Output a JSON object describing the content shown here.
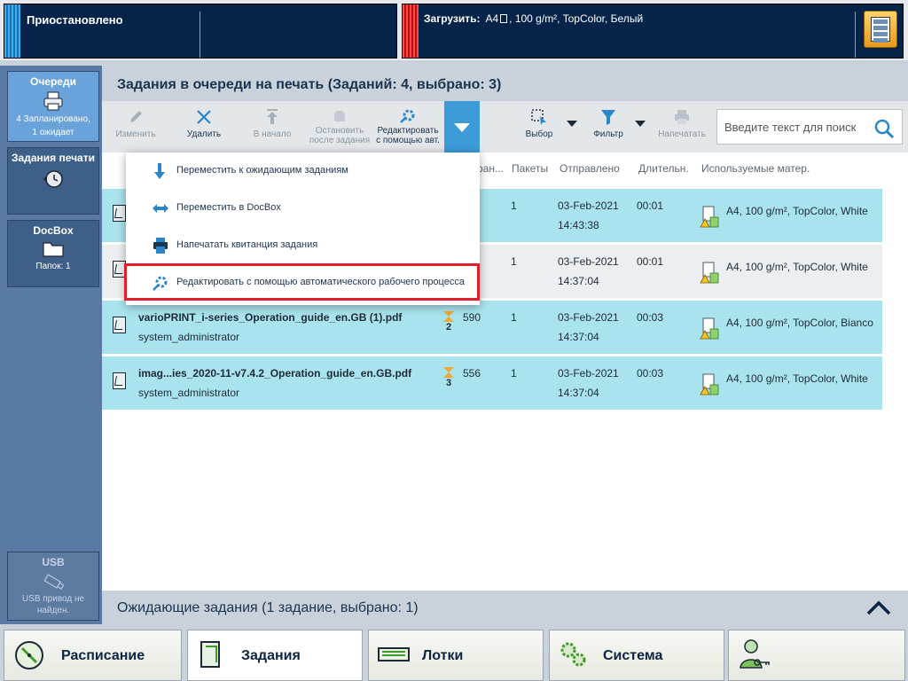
{
  "status_bar": {
    "printer_status": "Приостановлено",
    "load_label": "Загрузить:",
    "load_media_size": "A4",
    "load_media_details": ", 100 g/m², TopColor, Белый"
  },
  "sidebar": {
    "queues": {
      "title": "Очереди",
      "line1": "4 Запланировано,",
      "line2": "1 ожидает"
    },
    "print_jobs": {
      "title": "Задания печати"
    },
    "docbox": {
      "title": "DocBox",
      "sub": "Папок: 1"
    },
    "usb": {
      "title": "USB",
      "sub": "USB привод не найден."
    }
  },
  "main": {
    "title": "Задания в очереди на печать (Заданий: 4, выбрано: 3)",
    "toolbar": {
      "edit": "Изменить",
      "delete": "Удалить",
      "to_top": "В начало",
      "stop_after_line1": "Остановить",
      "stop_after_line2": "после задания",
      "edit_auto_line1": "Редактировать",
      "edit_auto_line2": "с помощью авт.",
      "select": "Выбор",
      "filter": "Фильтр",
      "print": "Напечатать"
    },
    "search": {
      "placeholder": "Введите текст для поиск"
    },
    "columns": {
      "pages_partial": "ран...",
      "packets": "Пакеты",
      "sent": "Отправлено",
      "duration": "Длительн.",
      "media": "Используемые матер."
    },
    "rows": [
      {
        "name": "",
        "owner": "",
        "prio": "",
        "pages": "",
        "packets": "1",
        "date": "03-Feb-2021",
        "time": "14:43:38",
        "duration": "00:01",
        "media": "A4, 100 g/m², TopColor, White"
      },
      {
        "name": "",
        "owner": "",
        "prio": "",
        "pages": "",
        "packets": "1",
        "date": "03-Feb-2021",
        "time": "14:37:04",
        "duration": "00:01",
        "media": "A4, 100 g/m², TopColor, White"
      },
      {
        "name": "varioPRINT_i-series_Operation_guide_en.GB (1).pdf",
        "owner": "system_administrator",
        "prio": "2",
        "pages": "590",
        "packets": "1",
        "date": "03-Feb-2021",
        "time": "14:37:04",
        "duration": "00:03",
        "media": "A4, 100 g/m², TopColor, Bianco"
      },
      {
        "name": "imag...ies_2020-11-v7.4.2_Operation_guide_en.GB.pdf",
        "owner": "system_administrator",
        "prio": "3",
        "pages": "556",
        "packets": "1",
        "date": "03-Feb-2021",
        "time": "14:37:04",
        "duration": "00:03",
        "media": "A4, 100 g/m², TopColor, White"
      }
    ],
    "menu": [
      "Переместить к ожидающим заданиям",
      "Переместить в DocBox",
      "Напечатать квитанция задания",
      "Редактировать с помощью автоматического рабочего процесса"
    ],
    "waiting": "Ожидающие задания (1 задание, выбрано: 1)"
  },
  "bottom_nav": {
    "schedule": "Расписание",
    "jobs": "Задания",
    "trays": "Лотки",
    "system": "Система"
  },
  "colors": {
    "accent_blue": "#3d9bd7",
    "row_selected": "#a9e3ed",
    "highlight_red": "#e11d2a",
    "header_navy": "#06244a"
  }
}
